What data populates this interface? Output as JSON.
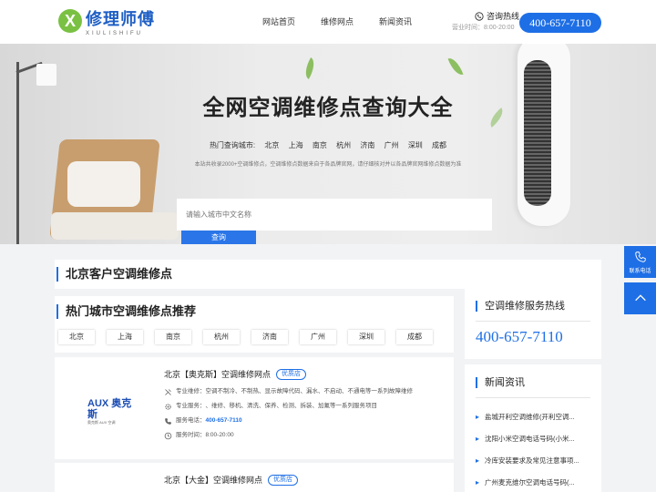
{
  "header": {
    "logo_mark": "X",
    "logo_text": "修理师傅",
    "logo_sub": "XIULISHIFU",
    "nav": [
      "网站首页",
      "维修网点",
      "新闻资讯"
    ],
    "hotline_label": "咨询热线",
    "hotline_hours": "营业时间：8:00-20:00",
    "phone": "400-657-7110"
  },
  "banner": {
    "title": "全网空调维修点查询大全",
    "hot_label": "热门查询城市:",
    "hot_cities": [
      "北京",
      "上海",
      "南京",
      "杭州",
      "济南",
      "广州",
      "深圳",
      "成都"
    ],
    "desc": "本站共收录2000+空调维修点，空调维修点数据来自于各品牌官网，请仔细核对并以各品牌官网维修点数据为准",
    "search_placeholder": "请输入城市中文名称",
    "search_button": "查询"
  },
  "side_tools": {
    "contact_label": "联系电话"
  },
  "main": {
    "section_title": "北京客户空调维修点",
    "city_section_title": "热门城市空调维修点推荐",
    "city_tabs": [
      "北京",
      "上海",
      "南京",
      "杭州",
      "济南",
      "广州",
      "深圳",
      "成都"
    ],
    "cards": [
      {
        "title": "北京【奥克斯】空调维修网点",
        "badge": "优质店",
        "logo_text": "AUX 奥克斯",
        "logo_sub": "奥克斯 AUX 空调",
        "repair_label": "专业维修：",
        "repair_value": "空调不制冷、不制热、显示故障代码、漏水、不启动、不通电等一系列故障维修",
        "service_label": "专业服务：",
        "service_value": "、维修、移机、清洗、保养、检测、拆装、加氟等一系列服务项目",
        "phone_label": "服务电话：",
        "phone_value": "400-657-7110",
        "hours_label": "服务时间：",
        "hours_value": "8:00-20:00"
      },
      {
        "title": "北京【大金】空调维修网点",
        "badge": "优质店"
      }
    ]
  },
  "sidebar": {
    "hotline_title": "空调维修服务热线",
    "hotline_phone": "400-657-7110",
    "news_title": "新闻资讯",
    "news": [
      "盐城开利空调维修(开利空调...",
      "沈阳小米空调电话号码(小米...",
      "冷库安装要求及常见注意事项...",
      "广州麦克维尔空调电话号码(..."
    ]
  },
  "colors": {
    "accent": "#1e6fe6",
    "logo_green": "#7ac143"
  }
}
